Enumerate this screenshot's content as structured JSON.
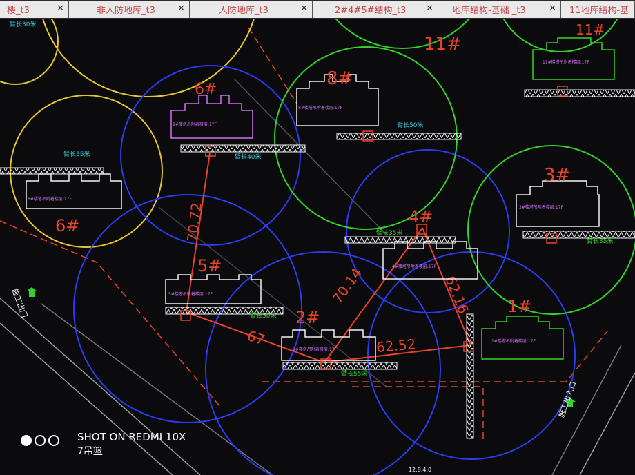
{
  "tabs": [
    {
      "label": "楼_t3"
    },
    {
      "label": "非人防地库_t3"
    },
    {
      "label": "人防地库_t3"
    },
    {
      "label": "2#4#5#结构_t3"
    },
    {
      "label": "地库结构-基础 _t3"
    },
    {
      "label": "11地库结构-基"
    }
  ],
  "tab_close_glyph": "✕",
  "cranes": [
    {
      "id": "1#",
      "radius_label": ""
    },
    {
      "id": "2#",
      "radius_label": "臂长55米"
    },
    {
      "id": "3#",
      "radius_label": "臂长35米"
    },
    {
      "id": "4#",
      "radius_label": "臂长35米"
    },
    {
      "id": "5#",
      "radius_label": "臂长50米"
    },
    {
      "id": "6#",
      "radius_label": "臂长35米"
    },
    {
      "id": "8#",
      "radius_label": "臂长50米"
    },
    {
      "id": "9#",
      "radius_label": "臂长40米"
    },
    {
      "id": "11#",
      "radius_label": ""
    }
  ],
  "top_left_label": "臂长30米",
  "building_notes": {
    "b9": "9#楼塔吊附着楼层:17F",
    "b8": "8#楼塔吊附着楼层:17F",
    "b3": "3#楼塔吊附着楼层:17F",
    "b11": "11#楼塔吊附着楼层:17F",
    "b6": "6#楼塔吊附着楼层:17F",
    "b5": "5#楼塔吊附着楼层:17F",
    "b4": "4#楼塔吊附着楼层:17F",
    "b2": "2#楼塔吊附着楼层:17F",
    "b1": "1#楼塔吊附着楼层:17F"
  },
  "distances": [
    "70.72",
    "67",
    "70.14",
    "62.52",
    "62.16"
  ],
  "entrances": [
    "施工出门",
    "施工出入口"
  ],
  "bottom_label": "12.8.4.0",
  "watermark": {
    "line1": "SHOT ON REDMI 10X",
    "line2": "7吊篮"
  },
  "colors": {
    "blue": "#2a3bf2",
    "green": "#34d12b",
    "yellow": "#e6c62e",
    "red": "#e8432a",
    "white": "#f2f2f2",
    "magenta": "#d070f0",
    "cyan": "#36c6d6"
  }
}
